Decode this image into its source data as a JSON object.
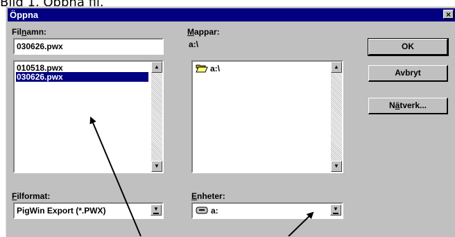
{
  "caption": "Bild 1. Öppna fil.",
  "dialog": {
    "title": "Öppna",
    "close_glyph": "×",
    "filename": {
      "label_pre": "Fil",
      "label_access": "n",
      "label_post": "amn:",
      "value": "030626.pwx",
      "files": [
        "010518.pwx",
        "030626.pwx"
      ],
      "selected_index": 1
    },
    "folders": {
      "label_access": "M",
      "label_post": "appar:",
      "path": "a:\\",
      "items": [
        {
          "name": "a:\\",
          "icon": "open-folder-icon"
        }
      ]
    },
    "filetype": {
      "label_access": "F",
      "label_post": "ilformat:",
      "value": "PigWin Export (*.PWX)"
    },
    "drives": {
      "label_access": "E",
      "label_post": "nheter:",
      "value": "a:",
      "icon": "floppy-drive-icon"
    },
    "buttons": {
      "ok": "OK",
      "cancel": "Avbryt",
      "network_pre": "N",
      "network_access": "ä",
      "network_post": "tverk..."
    }
  }
}
